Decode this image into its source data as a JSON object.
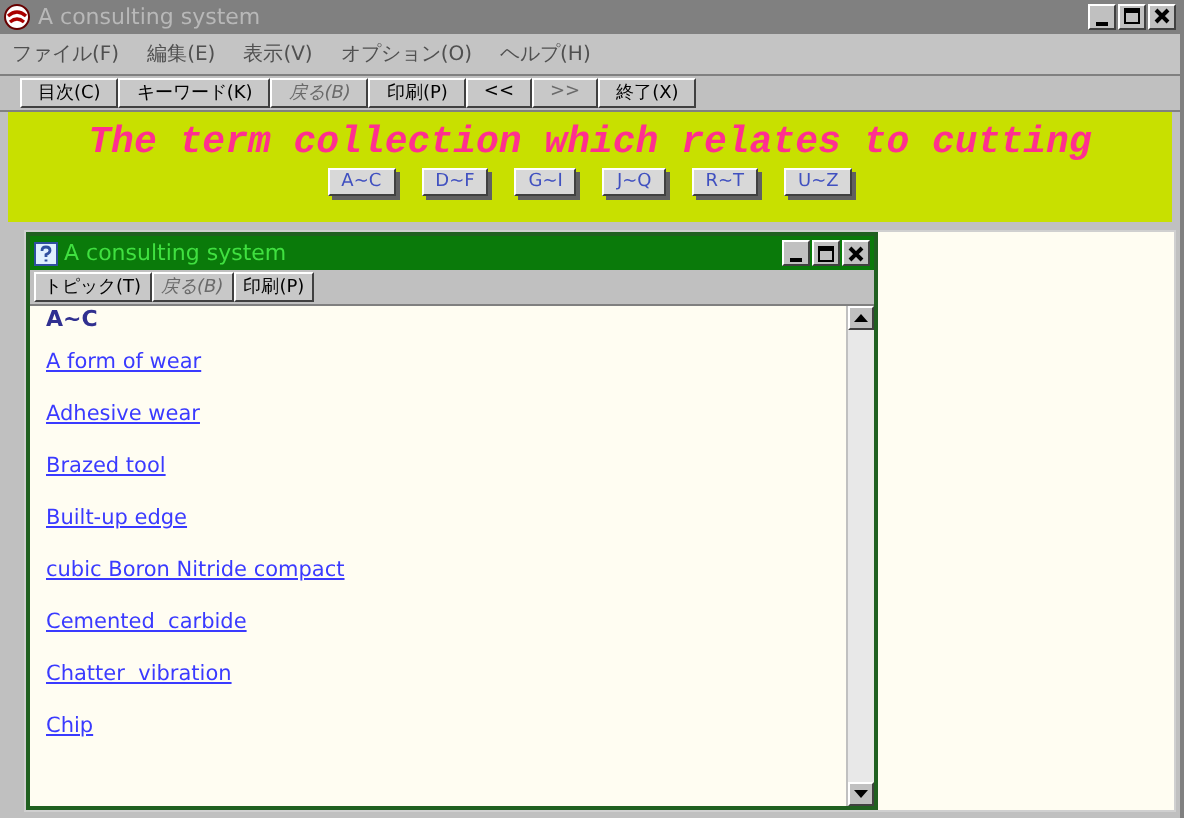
{
  "window": {
    "title": "A consulting system",
    "active": false
  },
  "menu": [
    {
      "label": "ファイル(F)"
    },
    {
      "label": "編集(E)"
    },
    {
      "label": "表示(V)"
    },
    {
      "label": "オプション(O)"
    },
    {
      "label": "ヘルプ(H)"
    }
  ],
  "toolbar": [
    {
      "label": "目次(C)",
      "disabled": false
    },
    {
      "label": "キーワード(K)",
      "disabled": false
    },
    {
      "label": "戻る(B)",
      "disabled": true
    },
    {
      "label": "印刷(P)",
      "disabled": false
    },
    {
      "label": "<<",
      "disabled": false
    },
    {
      "label": ">>",
      "disabled": true
    },
    {
      "label": "終了(X)",
      "disabled": false
    }
  ],
  "heading": "The term collection which relates to cutting",
  "ranges": [
    {
      "label": "A~C"
    },
    {
      "label": "D~F"
    },
    {
      "label": "G~I"
    },
    {
      "label": "J~Q"
    },
    {
      "label": "R~T"
    },
    {
      "label": "U~Z"
    }
  ],
  "child_window": {
    "title": "A consulting system",
    "active": true,
    "toolbar": [
      {
        "label": "トピック(T)",
        "disabled": false
      },
      {
        "label": "戻る(B)",
        "disabled": true
      },
      {
        "label": "印刷(P)",
        "disabled": false
      }
    ],
    "section": "A~C",
    "terms": [
      {
        "label": "A form of wear"
      },
      {
        "label": "Adhesive wear"
      },
      {
        "label": "Brazed tool"
      },
      {
        "label": "Built-up edge"
      },
      {
        "label": "cubic Boron Nitride compact"
      },
      {
        "label": "Cemented  carbide"
      },
      {
        "label": "Chatter  vibration"
      },
      {
        "label": "Chip"
      }
    ]
  }
}
